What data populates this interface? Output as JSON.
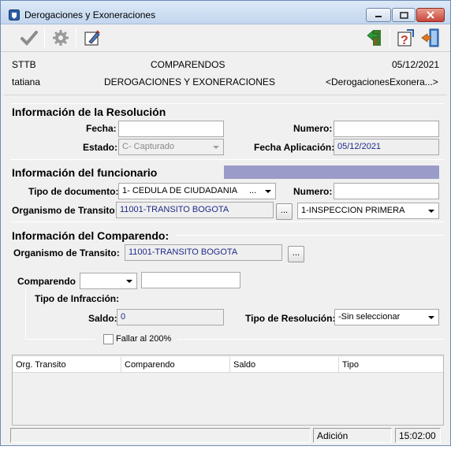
{
  "window": {
    "title": "Derogaciones y Exoneraciones"
  },
  "toolbar": {
    "left_icons": [
      "check-icon",
      "gear-icon",
      "edit-icon"
    ],
    "right_icons": [
      "back-arrow-icon",
      "help-icon",
      "exit-door-icon"
    ]
  },
  "header": {
    "system": "STTB",
    "module": "COMPARENDOS",
    "date": "05/12/2021",
    "user": "tatiana",
    "screen": "DEROGACIONES Y EXONERACIONES",
    "form_name": "<DerogacionesExonera...>"
  },
  "resolucion": {
    "title": "Información de la Resolución",
    "fecha_label": "Fecha:",
    "fecha_value": "",
    "numero_label": "Numero:",
    "numero_value": "",
    "estado_label": "Estado:",
    "estado_value": "C- Capturado",
    "fecha_aplicacion_label": "Fecha Aplicación:",
    "fecha_aplicacion_value": "05/12/2021"
  },
  "funcionario": {
    "title": "Información del funcionario",
    "tipo_doc_label": "Tipo de documento:",
    "tipo_doc_value": "1- CEDULA DE CIUDADANIA",
    "tipo_doc_more": "...",
    "numero_label": "Numero:",
    "numero_value": "",
    "organismo_label": "Organismo de Transito:",
    "organismo_value": "11001-TRANSITO BOGOTA",
    "organismo_button": "...",
    "inspeccion_value": "1-INSPECCION PRIMERA"
  },
  "comparendo": {
    "title": "Información del Comparendo:",
    "organismo_label": "Organismo de Transito:",
    "organismo_value": "11001-TRANSITO BOGOTA",
    "organismo_button": "...",
    "comparendo_label": "Comparendo",
    "comparendo_select": "",
    "comparendo_value": "",
    "tipo_infraccion_label": "Tipo de Infracción:",
    "saldo_label": "Saldo:",
    "saldo_value": "0",
    "tipo_resolucion_label": "Tipo de Resolución:",
    "tipo_resolucion_value": "-Sin seleccionar",
    "fallar_label": "Fallar al 200%",
    "fallar_checked": false
  },
  "grid": {
    "columns": [
      "Org. Transito",
      "Comparendo",
      "Saldo",
      "Tipo"
    ],
    "rows": []
  },
  "statusbar": {
    "message": "",
    "mode": "Adición",
    "time": "15:02:00"
  },
  "colors": {
    "purple_bar": "#9b9bc9",
    "readonly_text": "#1f2a8a"
  }
}
